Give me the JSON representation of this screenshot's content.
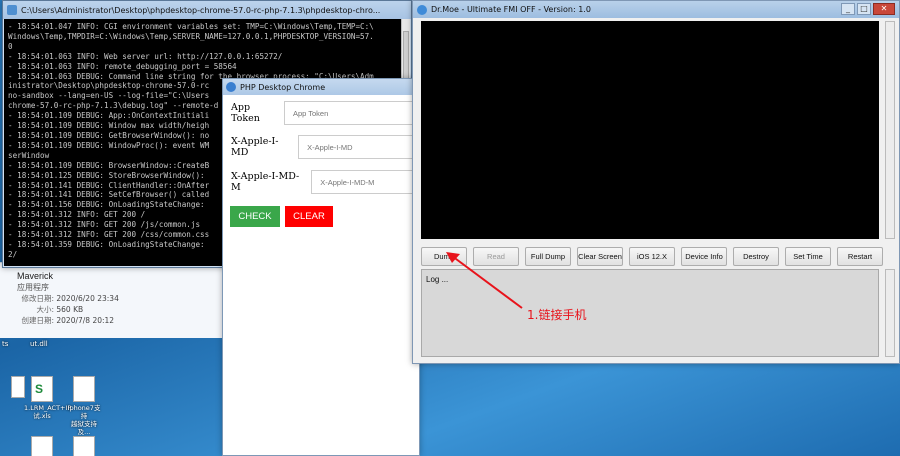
{
  "console": {
    "title": "C:\\Users\\Administrator\\Desktop\\phpdesktop-chrome-57.0-rc-php-7.1.3\\phpdesktop-chro...",
    "lines": [
      "- 18:54:01.047 INFO: CGI environment variables set: TMP=C:\\Windows\\Temp,TEMP=C:\\",
      "Windows\\Temp,TMPDIR=C:\\Windows\\Temp,SERVER_NAME=127.0.0.1,PHPDESKTOP_VERSION=57.",
      "0",
      "- 18:54:01.063 INFO: Web server url: http://127.0.0.1:65272/",
      "- 18:54:01.063 INFO: remote_debugging_port = 58564",
      "- 18:54:01.063 DEBUG: Command line string for the browser process: \"C:\\Users\\Adm",
      "inistrator\\Desktop\\phpdesktop-chrome-57.0-rc",
      "no-sandbox --lang=en-US --log-file=\"C:\\Users",
      "chrome-57.0-rc-php-7.1.3\\debug.log\" --remote-d",
      "- 18:54:01.109 DEBUG: App::OnContextInitiali",
      "- 18:54:01.109 DEBUG: Window max width/heigh",
      "- 18:54:01.109 DEBUG: GetBrowserWindow(): no",
      "- 18:54:01.109 DEBUG: WindowProc(): event WM",
      "serWindow",
      "- 18:54:01.109 DEBUG: BrowserWindow::CreateB",
      "- 18:54:01.125 DEBUG: StoreBrowserWindow():",
      "- 18:54:01.141 DEBUG: ClientHandler::OnAfter",
      "- 18:54:01.141 DEBUG: SetCefBrowser() called",
      "- 18:54:01.156 DEBUG: OnLoadingStateChange:",
      "- 18:54:01.312 INFO: GET 200 /",
      "- 18:54:01.312 INFO: GET 200 /js/common.js",
      "- 18:54:01.312 INFO: GET 200 /css/common.css",
      "- 18:54:01.359 DEBUG: OnLoadingStateChange:",
      "2/"
    ]
  },
  "explorer": {
    "name": "Maverick",
    "type": "应用程序",
    "modified_label": "修改日期:",
    "modified": "2020/6/20 23:34",
    "size_label": "大小:",
    "size": "560 KB",
    "created_label": "创建日期:",
    "created": "2020/7/8 20:12"
  },
  "desktop": {
    "top_icons": [
      "ts",
      "ut.dll"
    ],
    "icons": [
      "1.LRM_ACT+IP\n试.xls",
      "Iphone7支持\n越狱支持及..."
    ]
  },
  "php": {
    "title": "PHP Desktop Chrome",
    "fields": [
      {
        "label": "App Token",
        "placeholder": "App Token"
      },
      {
        "label": "X-Apple-I-MD",
        "placeholder": "X-Apple-I-MD"
      },
      {
        "label": "X-Apple-I-MD-M",
        "placeholder": "X-Apple-I-MD-M"
      }
    ],
    "check_label": "CHECK",
    "clear_label": "CLEAR",
    "check_color": "#3aa74a",
    "clear_color": "#ff0000"
  },
  "moe": {
    "title": "Dr.Moe - Ultimate FMI OFF - Version: 1.0",
    "buttons": [
      {
        "label": "Dump",
        "enabled": true
      },
      {
        "label": "Read",
        "enabled": false
      },
      {
        "label": "Full Dump",
        "enabled": true
      },
      {
        "label": "Clear Screen",
        "enabled": true
      },
      {
        "label": "iOS 12.X",
        "enabled": true
      },
      {
        "label": "Device Info",
        "enabled": true
      },
      {
        "label": "Destroy",
        "enabled": true
      },
      {
        "label": "Set Time",
        "enabled": true
      },
      {
        "label": "Restart",
        "enabled": true
      }
    ],
    "log_text": "Log ..."
  },
  "annotation": "1.链接手机"
}
